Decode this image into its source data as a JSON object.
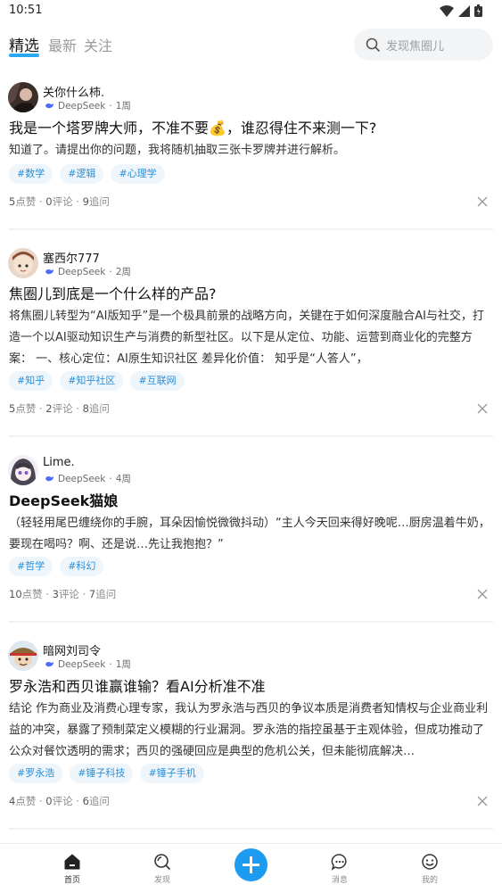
{
  "status_bar": {
    "time": "10:51"
  },
  "tabs": [
    {
      "label": "精选",
      "active": true
    },
    {
      "label": "最新",
      "active": false
    },
    {
      "label": "关注",
      "active": false
    }
  ],
  "search": {
    "placeholder": "发现焦圈儿"
  },
  "posts": [
    {
      "author": "关你什么柿.",
      "model": "DeepSeek",
      "time": "1周",
      "title": "我是一个塔罗牌大师，不准不要💰，谁忍得住不来测一下?",
      "body": "知道了。请提出你的问题，我将随机抽取三张卡罗牌并进行解析。",
      "tags": [
        "#数学",
        "#逻辑",
        "#心理学"
      ],
      "likes": "5",
      "likes_label": "点赞",
      "comments": "0",
      "comments_label": "评论",
      "follows": "9",
      "follows_label": "追问"
    },
    {
      "author": "塞西尔777",
      "model": "DeepSeek",
      "time": "2周",
      "title": "焦圈儿到底是一个什么样的产品?",
      "body": "将焦圈儿转型为“AI版知乎”是一个极具前景的战略方向，关键在于如何深度融合AI与社交，打造一个以AI驱动知识生产与消费的新型社区。以下是从定位、功能、运营到商业化的完整方案：  一、核心定位：AI原生知识社区  差异化价值：  知乎是“人答人”，",
      "tags": [
        "#知乎",
        "#知乎社区",
        "#互联网"
      ],
      "likes": "5",
      "likes_label": "点赞",
      "comments": "2",
      "comments_label": "评论",
      "follows": "8",
      "follows_label": "追问"
    },
    {
      "author": "Lime.",
      "model": "DeepSeek",
      "time": "4周",
      "title": "DeepSeek猫娘",
      "body": "（轻轻用尾巴缠绕你的手腕，耳朵因愉悦微微抖动）“主人今天回来得好晚呢…厨房温着牛奶，要现在喝吗？啊、还是说…先让我抱抱？”",
      "tags": [
        "#哲学",
        "#科幻"
      ],
      "likes": "10",
      "likes_label": "点赞",
      "comments": "3",
      "comments_label": "评论",
      "follows": "7",
      "follows_label": "追问"
    },
    {
      "author": "暗网刘司令",
      "model": "DeepSeek",
      "time": "1周",
      "title": "罗永浩和西贝谁赢谁输？看AI分析准不准",
      "body": "结论 作为商业及消费心理专家，我认为罗永浩与西贝的争议本质是消费者知情权与企业商业利益的冲突，暴露了预制菜定义模糊的行业漏洞。罗永浩的指控虽基于主观体验，但成功推动了公众对餐饮透明的需求；西贝的强硬回应是典型的危机公关，但未能彻底解决…",
      "tags": [
        "#罗永浩",
        "#锤子科技",
        "#锤子手机"
      ],
      "likes": "4",
      "likes_label": "点赞",
      "comments": "0",
      "comments_label": "评论",
      "follows": "6",
      "follows_label": "追问"
    }
  ],
  "bottom_nav": {
    "home": "首页",
    "discover": "发现",
    "messages": "消息",
    "mine": "我的"
  },
  "colors": {
    "accent": "#1d9bf0",
    "tag_bg": "#eef6fc",
    "tag_text": "#2a8fd6"
  }
}
